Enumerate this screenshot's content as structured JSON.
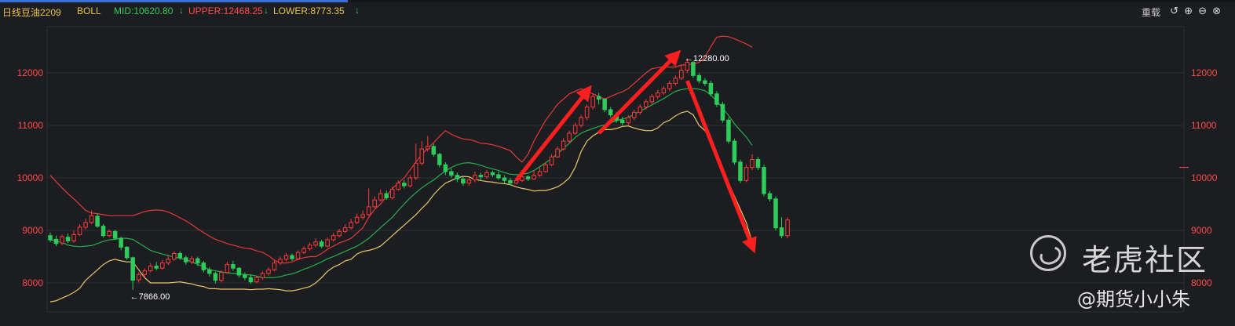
{
  "toolbar": {
    "period": "日线",
    "symbol": "豆油2209",
    "indicator": "BOLL",
    "mid": "MID:10620.80",
    "upper": "UPPER:12468.25",
    "lower": "LOWER:8773.35",
    "arrow": "↓",
    "reset": "重载",
    "icons": [
      "undo-icon",
      "zoom-in-icon",
      "zoom-out-icon",
      "close-icon"
    ]
  },
  "watermark": {
    "brand": "老虎社区",
    "author": "@期货小小朱"
  },
  "colors": {
    "up": "#ff3a3a",
    "down": "#2dcc5b",
    "mid": "#22b04a",
    "upper": "#e23a3a",
    "lower": "#e8c96a",
    "arrow": "#ff1f1f",
    "grid": "#2c2e34",
    "axis": "#ff4a4a"
  },
  "chart_data": {
    "type": "candlestick",
    "y_ticks": [
      8000,
      9000,
      10000,
      11000,
      12000
    ],
    "ylim": [
      7500,
      12900
    ],
    "x_count": 120,
    "grid": true,
    "annotations": [
      {
        "label": "12280.00",
        "index": 107,
        "value": 12280
      },
      {
        "label": "7866.00",
        "index": 13,
        "value": 7866
      }
    ],
    "current_value_marker": 10200,
    "trend_arrows": [
      {
        "from_index": 79,
        "from_value": 9950,
        "to_index": 91,
        "to_value": 11650
      },
      {
        "from_index": 93,
        "from_value": 10850,
        "to_index": 106,
        "to_value": 12330
      },
      {
        "from_index": 108,
        "from_value": 11850,
        "to_index": 119,
        "to_value": 8700
      }
    ],
    "bands": {
      "upper": [
        10050,
        9930,
        9810,
        9700,
        9600,
        9490,
        9380,
        9330,
        9320,
        9300,
        9280,
        9280,
        9280,
        9280,
        9280,
        9320,
        9360,
        9380,
        9390,
        9380,
        9350,
        9300,
        9240,
        9180,
        9110,
        9030,
        8960,
        8890,
        8830,
        8790,
        8750,
        8720,
        8690,
        8660,
        8650,
        8610,
        8580,
        8520,
        8430,
        8380,
        8380,
        8400,
        8450,
        8480,
        8500,
        8500,
        8560,
        8640,
        8700,
        8760,
        8800,
        8850,
        8950,
        9050,
        9250,
        9400,
        9500,
        9650,
        9800,
        9900,
        10000,
        10150,
        10300,
        10450,
        10560,
        10670,
        10790,
        10900,
        10830,
        10780,
        10740,
        10730,
        10700,
        10660,
        10650,
        10630,
        10600,
        10560,
        10520,
        10400,
        10300,
        10450,
        10700,
        10900,
        11100,
        11250,
        11400,
        11500,
        11600,
        11650,
        11700,
        11650,
        11600,
        11550,
        11500,
        11550,
        11600,
        11640,
        11700,
        11800,
        11900,
        12000,
        12080,
        12100,
        12120,
        12110,
        12110,
        12150,
        12150,
        12170,
        12200,
        12300,
        12500,
        12680,
        12700,
        12690,
        12650,
        12600,
        12550,
        12490
      ],
      "mid": [
        8820,
        8800,
        8770,
        8720,
        8700,
        8690,
        8700,
        8710,
        8750,
        8790,
        8820,
        8830,
        8850,
        8850,
        8830,
        8760,
        8690,
        8620,
        8580,
        8550,
        8520,
        8490,
        8470,
        8440,
        8400,
        8350,
        8310,
        8250,
        8230,
        8210,
        8190,
        8180,
        8170,
        8160,
        8150,
        8130,
        8100,
        8100,
        8100,
        8120,
        8150,
        8170,
        8210,
        8260,
        8300,
        8350,
        8400,
        8460,
        8500,
        8550,
        8600,
        8650,
        8700,
        8770,
        8850,
        8950,
        9050,
        9150,
        9250,
        9380,
        9500,
        9620,
        9720,
        9810,
        9890,
        9960,
        10050,
        10130,
        10200,
        10250,
        10280,
        10290,
        10270,
        10240,
        10200,
        10170,
        10140,
        10100,
        10070,
        10060,
        10070,
        10090,
        10140,
        10210,
        10290,
        10370,
        10460,
        10560,
        10660,
        10770,
        10850,
        10900,
        10940,
        10980,
        11010,
        11050,
        11090,
        11120,
        11150,
        11210,
        11270,
        11330,
        11390,
        11450,
        11510,
        11580,
        11650,
        11680,
        11700,
        11700,
        11690,
        11660,
        11580,
        11460,
        11330,
        11190,
        11030,
        10900,
        10780,
        10620
      ],
      "lower": [
        7640,
        7660,
        7710,
        7760,
        7820,
        7900,
        8050,
        8150,
        8250,
        8350,
        8420,
        8450,
        8420,
        8400,
        8400,
        8250,
        8100,
        8000,
        8000,
        8000,
        8000,
        8010,
        8020,
        8000,
        7980,
        7950,
        7930,
        7890,
        7890,
        7880,
        7880,
        7880,
        7880,
        7880,
        7870,
        7880,
        7880,
        7890,
        7880,
        7870,
        7850,
        7850,
        7870,
        7900,
        7930,
        8000,
        8100,
        8220,
        8300,
        8350,
        8420,
        8450,
        8550,
        8600,
        8620,
        8650,
        8700,
        8800,
        8900,
        9000,
        9100,
        9200,
        9300,
        9420,
        9530,
        9680,
        9800,
        9900,
        9950,
        10000,
        10030,
        10020,
        9970,
        9950,
        9930,
        9920,
        9900,
        9890,
        9870,
        9830,
        9800,
        9780,
        9750,
        9760,
        9760,
        9790,
        9830,
        9900,
        10000,
        10200,
        10500,
        10700,
        10800,
        10870,
        10920,
        10920,
        10940,
        10980,
        10990,
        10950,
        10920,
        10900,
        10900,
        10950,
        11050,
        11100,
        11180,
        11240,
        11270,
        11200,
        11000,
        10900,
        10700,
        10450,
        10150,
        9900,
        9650,
        9400,
        9150,
        8773
      ]
    },
    "candles": [
      [
        8900,
        8820,
        8960,
        8780
      ],
      [
        8830,
        8750,
        8900,
        8700
      ],
      [
        8760,
        8880,
        8920,
        8720
      ],
      [
        8870,
        8800,
        8940,
        8760
      ],
      [
        8800,
        8920,
        8990,
        8770
      ],
      [
        8920,
        9060,
        9120,
        8890
      ],
      [
        9060,
        9150,
        9220,
        9020
      ],
      [
        9150,
        9280,
        9380,
        9120
      ],
      [
        9270,
        9080,
        9320,
        9050
      ],
      [
        9080,
        8900,
        9120,
        8860
      ],
      [
        8900,
        8980,
        9020,
        8870
      ],
      [
        8980,
        8850,
        9010,
        8820
      ],
      [
        8850,
        8680,
        8880,
        8620
      ],
      [
        8680,
        8480,
        8700,
        8440
      ],
      [
        8480,
        8050,
        8500,
        7866
      ],
      [
        8060,
        8160,
        8200,
        8010
      ],
      [
        8160,
        8230,
        8280,
        8100
      ],
      [
        8230,
        8320,
        8380,
        8200
      ],
      [
        8320,
        8280,
        8400,
        8240
      ],
      [
        8280,
        8380,
        8430,
        8250
      ],
      [
        8380,
        8450,
        8520,
        8340
      ],
      [
        8450,
        8560,
        8600,
        8420
      ],
      [
        8560,
        8480,
        8600,
        8440
      ],
      [
        8480,
        8400,
        8520,
        8350
      ],
      [
        8400,
        8460,
        8510,
        8360
      ],
      [
        8460,
        8380,
        8500,
        8320
      ],
      [
        8380,
        8250,
        8420,
        8200
      ],
      [
        8250,
        8180,
        8300,
        8120
      ],
      [
        8180,
        8050,
        8210,
        7990
      ],
      [
        8050,
        8200,
        8240,
        8010
      ],
      [
        8200,
        8350,
        8400,
        8180
      ],
      [
        8350,
        8280,
        8420,
        8230
      ],
      [
        8280,
        8150,
        8300,
        8100
      ],
      [
        8150,
        8100,
        8200,
        8050
      ],
      [
        8100,
        8020,
        8160,
        7980
      ],
      [
        8020,
        8100,
        8140,
        7990
      ],
      [
        8100,
        8180,
        8220,
        8060
      ],
      [
        8180,
        8250,
        8300,
        8140
      ],
      [
        8250,
        8380,
        8430,
        8220
      ],
      [
        8380,
        8450,
        8500,
        8340
      ],
      [
        8450,
        8520,
        8570,
        8410
      ],
      [
        8520,
        8460,
        8560,
        8420
      ],
      [
        8460,
        8580,
        8620,
        8430
      ],
      [
        8580,
        8650,
        8700,
        8550
      ],
      [
        8650,
        8720,
        8770,
        8610
      ],
      [
        8720,
        8780,
        8850,
        8680
      ],
      [
        8780,
        8700,
        8820,
        8660
      ],
      [
        8700,
        8820,
        8870,
        8680
      ],
      [
        8820,
        8900,
        8950,
        8790
      ],
      [
        8900,
        8980,
        9030,
        8870
      ],
      [
        8980,
        9050,
        9120,
        8950
      ],
      [
        9050,
        9150,
        9220,
        9020
      ],
      [
        9150,
        9250,
        9320,
        9120
      ],
      [
        9250,
        9300,
        9380,
        9200
      ],
      [
        9300,
        9450,
        9800,
        9280
      ],
      [
        9450,
        9580,
        9650,
        9420
      ],
      [
        9580,
        9700,
        9780,
        9550
      ],
      [
        9700,
        9620,
        9760,
        9580
      ],
      [
        9620,
        9780,
        9830,
        9590
      ],
      [
        9780,
        9900,
        9950,
        9760
      ],
      [
        9900,
        9850,
        9960,
        9800
      ],
      [
        9850,
        10000,
        10060,
        9820
      ],
      [
        10000,
        10280,
        10650,
        9960
      ],
      [
        10280,
        10550,
        10700,
        10240
      ],
      [
        10550,
        10600,
        10800,
        10500
      ],
      [
        10600,
        10450,
        10650,
        10400
      ],
      [
        10450,
        10250,
        10480,
        10200
      ],
      [
        10250,
        10120,
        10300,
        10050
      ],
      [
        10120,
        10050,
        10180,
        10000
      ],
      [
        10050,
        9980,
        10100,
        9920
      ],
      [
        9980,
        9900,
        10020,
        9850
      ],
      [
        9900,
        9960,
        10000,
        9850
      ],
      [
        9960,
        10050,
        10120,
        9920
      ],
      [
        10050,
        10020,
        10100,
        9960
      ],
      [
        10020,
        10100,
        10150,
        9980
      ],
      [
        10100,
        10060,
        10140,
        10020
      ],
      [
        10060,
        10000,
        10120,
        9960
      ],
      [
        10000,
        9950,
        10050,
        9900
      ],
      [
        9950,
        9900,
        10000,
        9860
      ],
      [
        9900,
        9950,
        9980,
        9880
      ],
      [
        9950,
        10020,
        10060,
        9920
      ],
      [
        10020,
        9980,
        10050,
        9940
      ],
      [
        9980,
        10050,
        10150,
        9960
      ],
      [
        10050,
        10120,
        10200,
        10020
      ],
      [
        10120,
        10250,
        10300,
        10100
      ],
      [
        10250,
        10400,
        10450,
        10220
      ],
      [
        10400,
        10550,
        10600,
        10380
      ],
      [
        10550,
        10700,
        10760,
        10520
      ],
      [
        10700,
        10850,
        10900,
        10660
      ],
      [
        10850,
        11000,
        11050,
        10820
      ],
      [
        11000,
        11150,
        11200,
        10960
      ],
      [
        11150,
        11350,
        11400,
        11100
      ],
      [
        11350,
        11550,
        11600,
        11300
      ],
      [
        11550,
        11500,
        11620,
        11400
      ],
      [
        11500,
        11300,
        11520,
        11250
      ],
      [
        11300,
        11200,
        11350,
        11150
      ],
      [
        11200,
        11100,
        11250,
        11050
      ],
      [
        11100,
        11050,
        11160,
        11000
      ],
      [
        11050,
        11150,
        11200,
        11000
      ],
      [
        11150,
        11250,
        11300,
        11100
      ],
      [
        11250,
        11350,
        11400,
        11200
      ],
      [
        11350,
        11450,
        11500,
        11300
      ],
      [
        11450,
        11550,
        11600,
        11400
      ],
      [
        11550,
        11620,
        11680,
        11500
      ],
      [
        11620,
        11700,
        11750,
        11580
      ],
      [
        11700,
        11800,
        11850,
        11650
      ],
      [
        11800,
        11900,
        11950,
        11760
      ],
      [
        11900,
        12050,
        12150,
        11860
      ],
      [
        12050,
        12200,
        12280,
        12000
      ],
      [
        12200,
        11950,
        12220,
        11900
      ],
      [
        11950,
        11850,
        12000,
        11800
      ],
      [
        11850,
        11800,
        11900,
        11750
      ],
      [
        11800,
        11600,
        11850,
        11550
      ],
      [
        11600,
        11400,
        11650,
        11350
      ],
      [
        11400,
        11100,
        11450,
        11050
      ],
      [
        11100,
        10700,
        11150,
        10650
      ],
      [
        10700,
        10300,
        10750,
        10250
      ],
      [
        10300,
        9950,
        10350,
        9900
      ],
      [
        9950,
        10200,
        10250,
        9920
      ],
      [
        10200,
        10350,
        10450,
        10150
      ],
      [
        10350,
        10200,
        10400,
        10150
      ],
      [
        10200,
        9700,
        10250,
        9650
      ],
      [
        9700,
        9600,
        9750,
        9550
      ],
      [
        9600,
        9050,
        9650,
        9000
      ],
      [
        9050,
        8900,
        9250,
        8850
      ],
      [
        8900,
        9200,
        9250,
        8850
      ]
    ]
  }
}
